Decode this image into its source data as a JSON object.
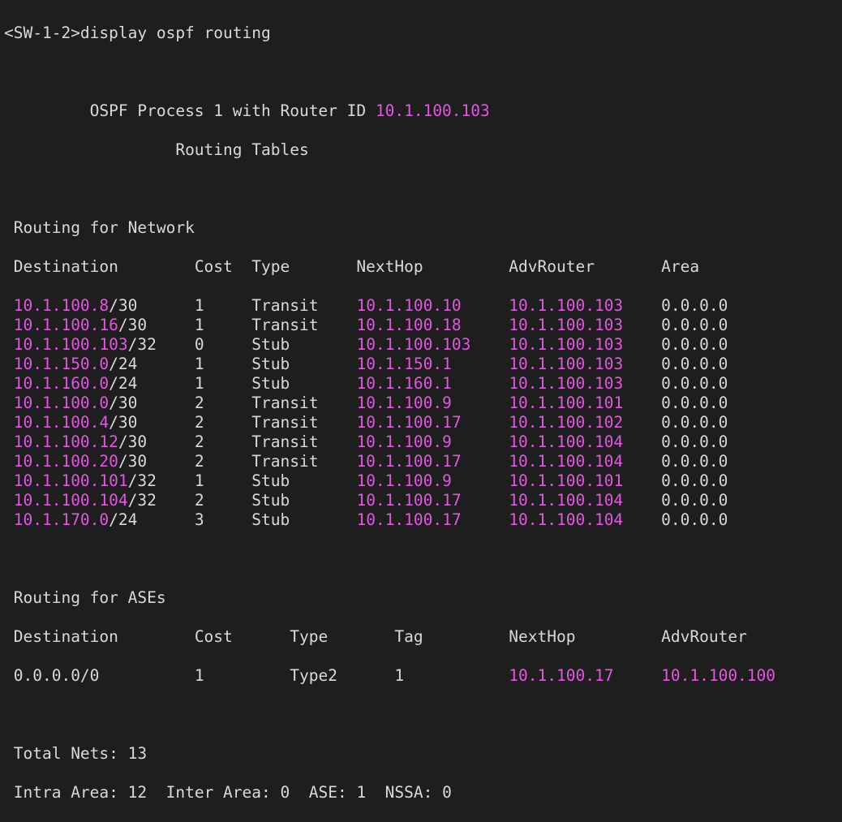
{
  "window": {
    "prompt": "<SW-1-2>",
    "command": "display ospf routing"
  },
  "header": {
    "process_text": "OSPF Process 1 with Router ID ",
    "router_id": "10.1.100.103",
    "subtitle": "Routing Tables"
  },
  "network_section": {
    "title": "Routing for Network",
    "columns": [
      "Destination",
      "Cost",
      "Type",
      "NextHop",
      "AdvRouter",
      "Area"
    ],
    "rows": [
      {
        "dest_ip": "10.1.100.8",
        "mask": "/30",
        "cost": "1",
        "type": "Transit",
        "nexthop": "10.1.100.10",
        "advrouter": "10.1.100.103",
        "area": "0.0.0.0"
      },
      {
        "dest_ip": "10.1.100.16",
        "mask": "/30",
        "cost": "1",
        "type": "Transit",
        "nexthop": "10.1.100.18",
        "advrouter": "10.1.100.103",
        "area": "0.0.0.0"
      },
      {
        "dest_ip": "10.1.100.103",
        "mask": "/32",
        "cost": "0",
        "type": "Stub",
        "nexthop": "10.1.100.103",
        "advrouter": "10.1.100.103",
        "area": "0.0.0.0"
      },
      {
        "dest_ip": "10.1.150.0",
        "mask": "/24",
        "cost": "1",
        "type": "Stub",
        "nexthop": "10.1.150.1",
        "advrouter": "10.1.100.103",
        "area": "0.0.0.0"
      },
      {
        "dest_ip": "10.1.160.0",
        "mask": "/24",
        "cost": "1",
        "type": "Stub",
        "nexthop": "10.1.160.1",
        "advrouter": "10.1.100.103",
        "area": "0.0.0.0"
      },
      {
        "dest_ip": "10.1.100.0",
        "mask": "/30",
        "cost": "2",
        "type": "Transit",
        "nexthop": "10.1.100.9",
        "advrouter": "10.1.100.101",
        "area": "0.0.0.0"
      },
      {
        "dest_ip": "10.1.100.4",
        "mask": "/30",
        "cost": "2",
        "type": "Transit",
        "nexthop": "10.1.100.17",
        "advrouter": "10.1.100.102",
        "area": "0.0.0.0"
      },
      {
        "dest_ip": "10.1.100.12",
        "mask": "/30",
        "cost": "2",
        "type": "Transit",
        "nexthop": "10.1.100.9",
        "advrouter": "10.1.100.104",
        "area": "0.0.0.0"
      },
      {
        "dest_ip": "10.1.100.20",
        "mask": "/30",
        "cost": "2",
        "type": "Transit",
        "nexthop": "10.1.100.17",
        "advrouter": "10.1.100.104",
        "area": "0.0.0.0"
      },
      {
        "dest_ip": "10.1.100.101",
        "mask": "/32",
        "cost": "1",
        "type": "Stub",
        "nexthop": "10.1.100.9",
        "advrouter": "10.1.100.101",
        "area": "0.0.0.0"
      },
      {
        "dest_ip": "10.1.100.104",
        "mask": "/32",
        "cost": "2",
        "type": "Stub",
        "nexthop": "10.1.100.17",
        "advrouter": "10.1.100.104",
        "area": "0.0.0.0"
      },
      {
        "dest_ip": "10.1.170.0",
        "mask": "/24",
        "cost": "3",
        "type": "Stub",
        "nexthop": "10.1.100.17",
        "advrouter": "10.1.100.104",
        "area": "0.0.0.0"
      }
    ]
  },
  "ase_section": {
    "title": "Routing for ASEs",
    "columns": [
      "Destination",
      "Cost",
      "Type",
      "Tag",
      "NextHop",
      "AdvRouter"
    ],
    "rows": [
      {
        "dest": "0.0.0.0/0",
        "cost": "1",
        "type": "Type2",
        "tag": "1",
        "nexthop": "10.1.100.17",
        "advrouter": "10.1.100.100"
      }
    ]
  },
  "summary": {
    "total_nets_label": "Total Nets: ",
    "total_nets": "13",
    "intra_label": "Intra Area: ",
    "intra": "12",
    "inter_label": "  Inter Area: ",
    "inter": "0",
    "ase_label": "  ASE: ",
    "ase": "1",
    "nssa_label": "  NSSA: ",
    "nssa": "0"
  },
  "colors": {
    "background": "#1e1e1e",
    "text": "#d9d9d9",
    "ip_highlight": "#e455e4"
  }
}
